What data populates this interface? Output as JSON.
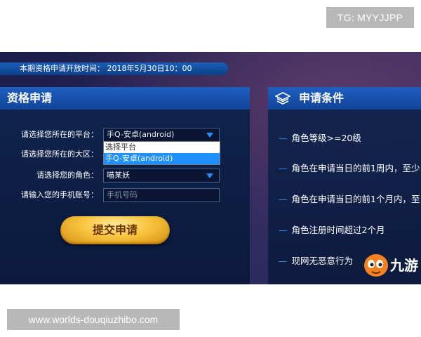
{
  "badges": {
    "tg": "TG: MYYJJPP",
    "website": "www.worlds-douqiuzhibo.com"
  },
  "topbar": {
    "text": "本期资格申请开放时间： 2018年5月30日10：00"
  },
  "apply_panel": {
    "title": "资格申请",
    "fields": [
      {
        "label": "请选择您所在的平台：",
        "value": "手Q-安卓(android)",
        "type": "select"
      },
      {
        "label": "请选择您所在的大区：",
        "value": "",
        "type": "select"
      },
      {
        "label": "请选择您的角色：",
        "value": "喵某妖",
        "type": "select"
      },
      {
        "label": "请输入您的手机账号：",
        "placeholder": "手机号码",
        "type": "input"
      }
    ],
    "platform_dropdown": {
      "options": [
        "选择平台",
        "手Q-安卓(android)"
      ],
      "selected": "手Q-安卓(android)"
    },
    "submit_label": "提交申请"
  },
  "conditions_panel": {
    "title": "申请条件",
    "items": [
      "角色等级>=20级",
      "角色在申请当日的前1周内，至少",
      "角色在申请当日的前1个月内，至",
      "角色注册时间超过2个月",
      "现网无恶意行为"
    ]
  },
  "logo": {
    "text": "九游"
  },
  "colors": {
    "accent": "#1e5fc0",
    "arrow": "#2a8cf0",
    "button": "#f7c43c"
  }
}
